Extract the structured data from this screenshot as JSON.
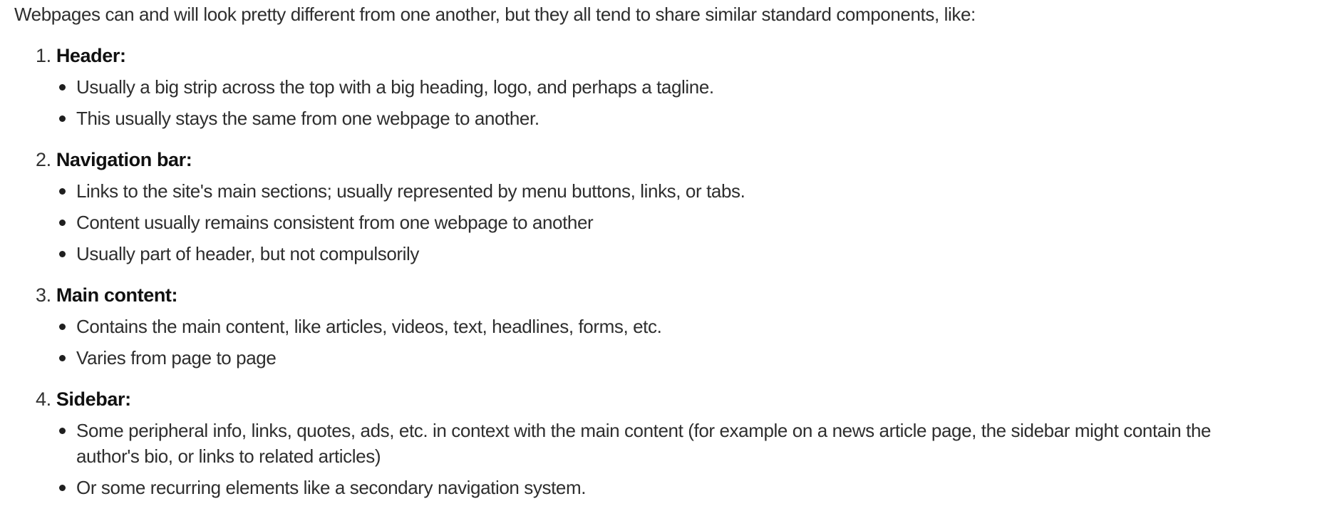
{
  "intro": "Webpages can and will look pretty different from one another, but they all tend to share similar standard components, like:",
  "sections": [
    {
      "number": "1.",
      "title": "Header:",
      "points": [
        "Usually a big strip across the top with a big heading, logo, and perhaps a tagline.",
        "This usually stays the same from one webpage to another."
      ]
    },
    {
      "number": "2.",
      "title": "Navigation bar:",
      "points": [
        "Links to the site's main sections; usually represented by menu buttons, links, or tabs.",
        "Content usually remains consistent from one webpage to another",
        "Usually part of header, but not compulsorily"
      ]
    },
    {
      "number": "3.",
      "title": "Main content:",
      "points": [
        "Contains the main content, like articles, videos, text, headlines, forms, etc.",
        "Varies from page to page"
      ]
    },
    {
      "number": "4.",
      "title": "Sidebar:",
      "points": [
        "Some peripheral info, links, quotes, ads, etc. in context with the main content (for example on a news article page, the sidebar might contain the author's bio, or links to related articles)",
        "Or some recurring elements like a secondary navigation system."
      ]
    }
  ]
}
